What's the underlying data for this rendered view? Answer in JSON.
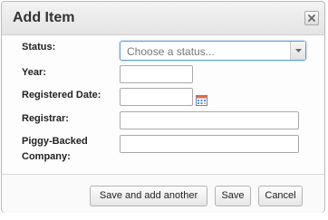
{
  "dialog": {
    "title": "Add Item",
    "close_icon": "close-icon"
  },
  "form": {
    "status_label": "Status:",
    "status_value": "Choose a status...",
    "year_label": "Year:",
    "year_value": "",
    "registered_date_label": "Registered Date:",
    "registered_date_value": "",
    "calendar_icon": "calendar-icon",
    "registrar_label": "Registrar:",
    "registrar_value": "",
    "piggy_label_line1": "Piggy-Backed",
    "piggy_label_line2": "Company:",
    "piggy_value": ""
  },
  "footer": {
    "save_add_another_label": "Save and add another",
    "save_label": "Save",
    "cancel_label": "Cancel"
  },
  "colors": {
    "focus_border": "#5b9dd9",
    "titlebar": "#e9e9e9"
  }
}
